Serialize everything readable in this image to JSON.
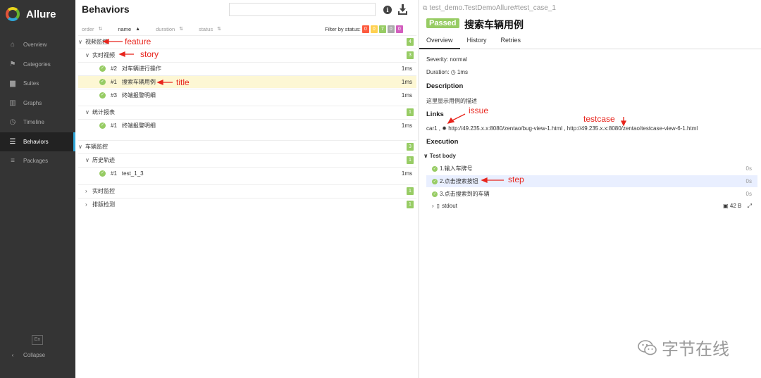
{
  "app": {
    "name": "Allure"
  },
  "sidebar": {
    "items": [
      {
        "label": "Overview",
        "icon": "home-icon"
      },
      {
        "label": "Categories",
        "icon": "flag-icon"
      },
      {
        "label": "Suites",
        "icon": "briefcase-icon"
      },
      {
        "label": "Graphs",
        "icon": "bar-chart-icon"
      },
      {
        "label": "Timeline",
        "icon": "clock-icon"
      },
      {
        "label": "Behaviors",
        "icon": "list-icon",
        "active": true
      },
      {
        "label": "Packages",
        "icon": "align-left-icon"
      }
    ],
    "lang": "En",
    "collapse": "Collapse"
  },
  "behaviors": {
    "title": "Behaviors",
    "sort": {
      "order": "order",
      "name": "name",
      "duration": "duration",
      "status": "status"
    },
    "filter_label": "Filter by status:",
    "status_counts": [
      {
        "value": "0",
        "color": "#fd5a3e"
      },
      {
        "value": "0",
        "color": "#ffd050"
      },
      {
        "value": "7",
        "color": "#97cc64"
      },
      {
        "value": "0",
        "color": "#aaaaaa"
      },
      {
        "value": "0",
        "color": "#d35ebe"
      }
    ],
    "tree": {
      "f1": {
        "label": "视频监控",
        "count": "4"
      },
      "s1": {
        "label": "实时视频",
        "count": "3"
      },
      "t1": {
        "order": "#2",
        "label": "对车辆进行操作",
        "duration": "1ms"
      },
      "t2": {
        "order": "#1",
        "label": "搜索车辆用例",
        "duration": "1ms"
      },
      "t3": {
        "order": "#3",
        "label": "终端报警明细",
        "duration": "1ms"
      },
      "s2": {
        "label": "统计报表",
        "count": "1"
      },
      "t4": {
        "order": "#1",
        "label": "终端报警明细",
        "duration": "1ms"
      },
      "f2": {
        "label": "车辆监控",
        "count": "3"
      },
      "s3": {
        "label": "历史轨迹",
        "count": "1"
      },
      "t5": {
        "order": "#1",
        "label": "test_1_3",
        "duration": "1ms"
      },
      "s4": {
        "label": "实时监控",
        "count": "1"
      },
      "s5": {
        "label": "排版检测",
        "count": "1"
      }
    }
  },
  "testcase": {
    "breadcrumb": "test_demo.TestDemoAllure#test_case_1",
    "status": "Passed",
    "title": "搜索车辆用例",
    "tabs": [
      "Overview",
      "History",
      "Retries"
    ],
    "severity": "Severity: normal",
    "duration_label": "Duration:",
    "duration_value": "1ms",
    "description_h": "Description",
    "description": "这里显示用例的描述",
    "links_h": "Links",
    "links_text_1": "car1 ,",
    "links_text_2": "http://49.235.x.x:8080/zentao/bug-view-1.html , http://49.235.x.x:8080/zentao/testcase-view-6-1.html",
    "execution_h": "Execution",
    "test_body": "Test body",
    "steps": [
      {
        "label": "1.输入车牌号",
        "duration": "0s"
      },
      {
        "label": "2.点击搜索按钮",
        "duration": "0s"
      },
      {
        "label": "3.点击搜索到的车辆",
        "duration": "0s"
      }
    ],
    "stdout": "stdout",
    "stdout_size": "42 B"
  },
  "annotations": {
    "feature": "feature",
    "story": "story",
    "title": "title",
    "issue": "issue",
    "testcase": "testcase",
    "step": "step"
  },
  "watermark": "字节在线",
  "colors": {
    "passed": "#97cc64",
    "sidebar": "#343434",
    "annotation": "#e8251d",
    "accent": "#2fa6d8"
  }
}
